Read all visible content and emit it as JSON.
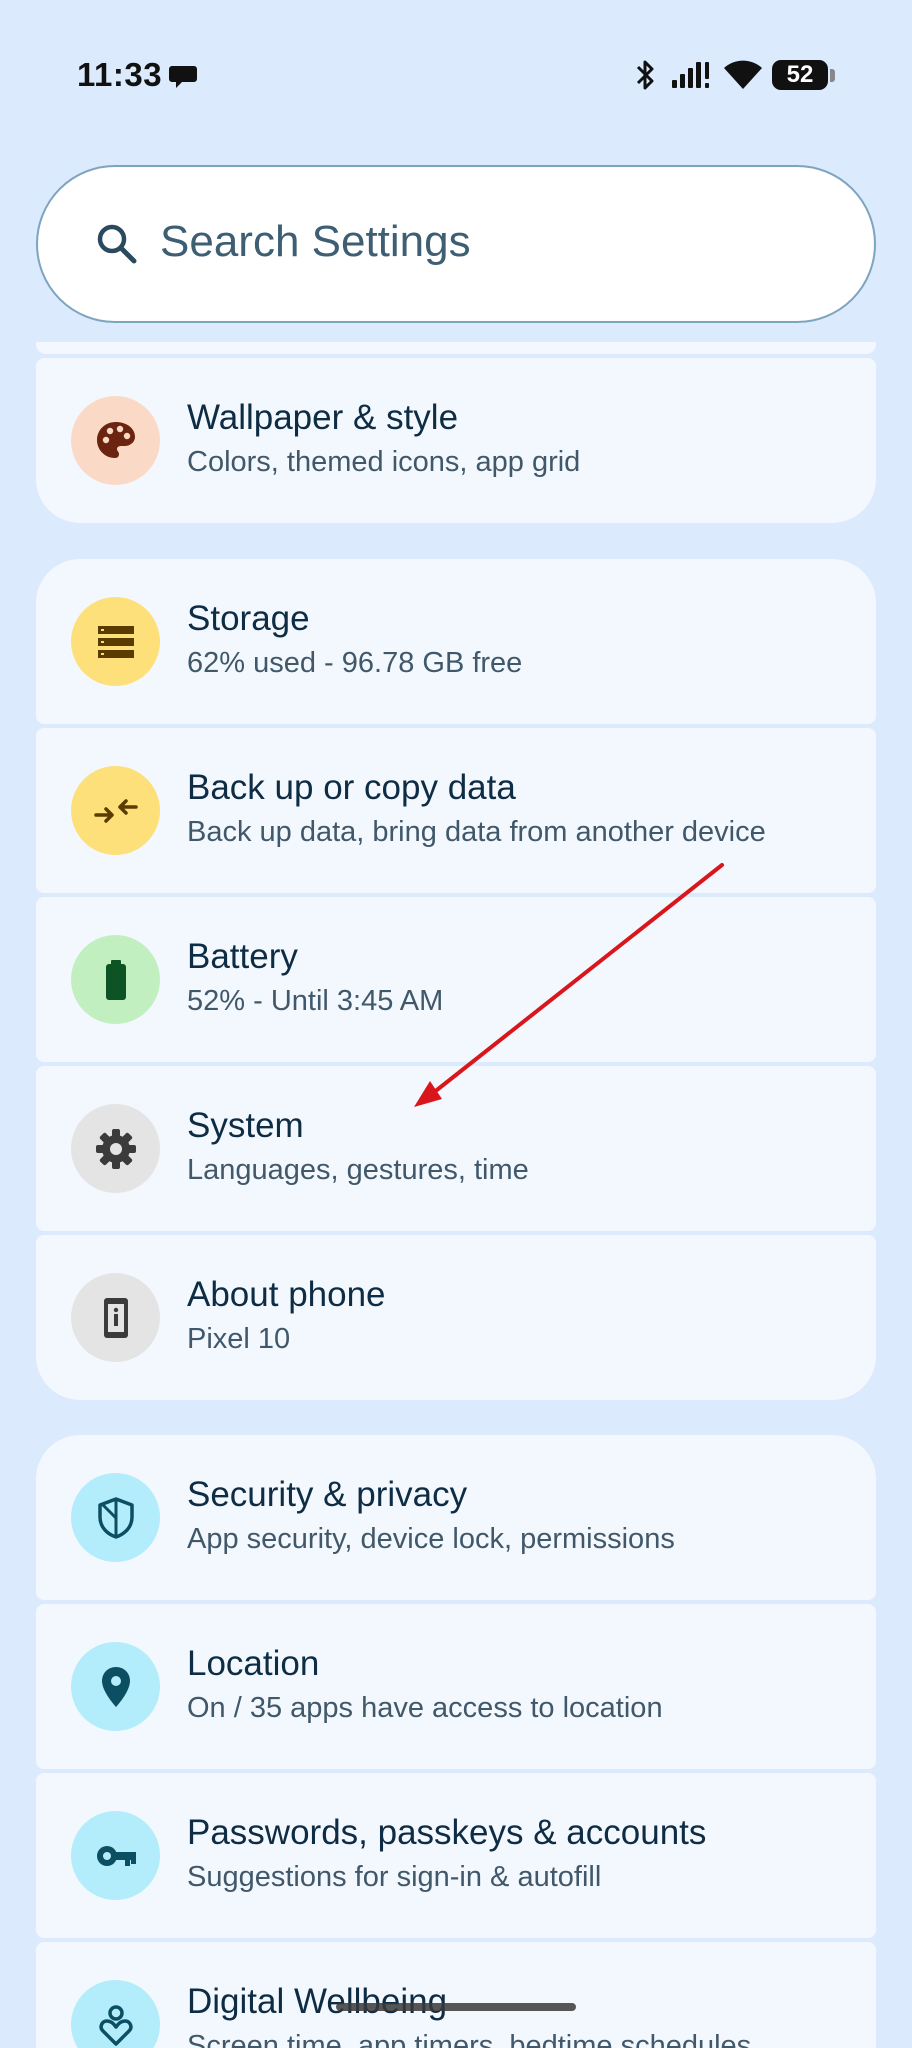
{
  "status_bar": {
    "time": "11:33",
    "battery_percent": "52"
  },
  "search": {
    "placeholder": "Search Settings"
  },
  "colors": {
    "background": "#dbeafd",
    "card": "#f3f8fe",
    "annotation_arrow": "#d9161b"
  },
  "items": [
    {
      "title": "Wallpaper & style",
      "subtitle": "Colors, themed icons, app grid",
      "icon": "palette-icon",
      "icon_bg": "#fbd9c7"
    },
    {
      "title": "Storage",
      "subtitle": "62% used - 96.78 GB free",
      "icon": "storage-icon",
      "icon_bg": "#fde07a"
    },
    {
      "title": "Back up or copy data",
      "subtitle": "Back up data, bring data from another device",
      "icon": "backup-icon",
      "icon_bg": "#fde07a"
    },
    {
      "title": "Battery",
      "subtitle": "52% - Until 3:45 AM",
      "icon": "battery-icon",
      "icon_bg": "#c2efc0"
    },
    {
      "title": "System",
      "subtitle": "Languages, gestures, time",
      "icon": "gear-icon",
      "icon_bg": "#e4e4e4"
    },
    {
      "title": "About phone",
      "subtitle": "Pixel 10",
      "icon": "phone-info-icon",
      "icon_bg": "#e4e4e4"
    },
    {
      "title": "Security & privacy",
      "subtitle": "App security, device lock, permissions",
      "icon": "shield-icon",
      "icon_bg": "#b3ecfb"
    },
    {
      "title": "Location",
      "subtitle": "On / 35 apps have access to location",
      "icon": "location-pin-icon",
      "icon_bg": "#b3ecfb"
    },
    {
      "title": "Passwords, passkeys & accounts",
      "subtitle": "Suggestions for sign-in & autofill",
      "icon": "key-icon",
      "icon_bg": "#b3ecfb"
    },
    {
      "title": "Digital Wellbeing",
      "subtitle": "Screen time, app timers, bedtime schedules",
      "icon": "wellbeing-icon",
      "icon_bg": "#b3ecfb"
    }
  ]
}
